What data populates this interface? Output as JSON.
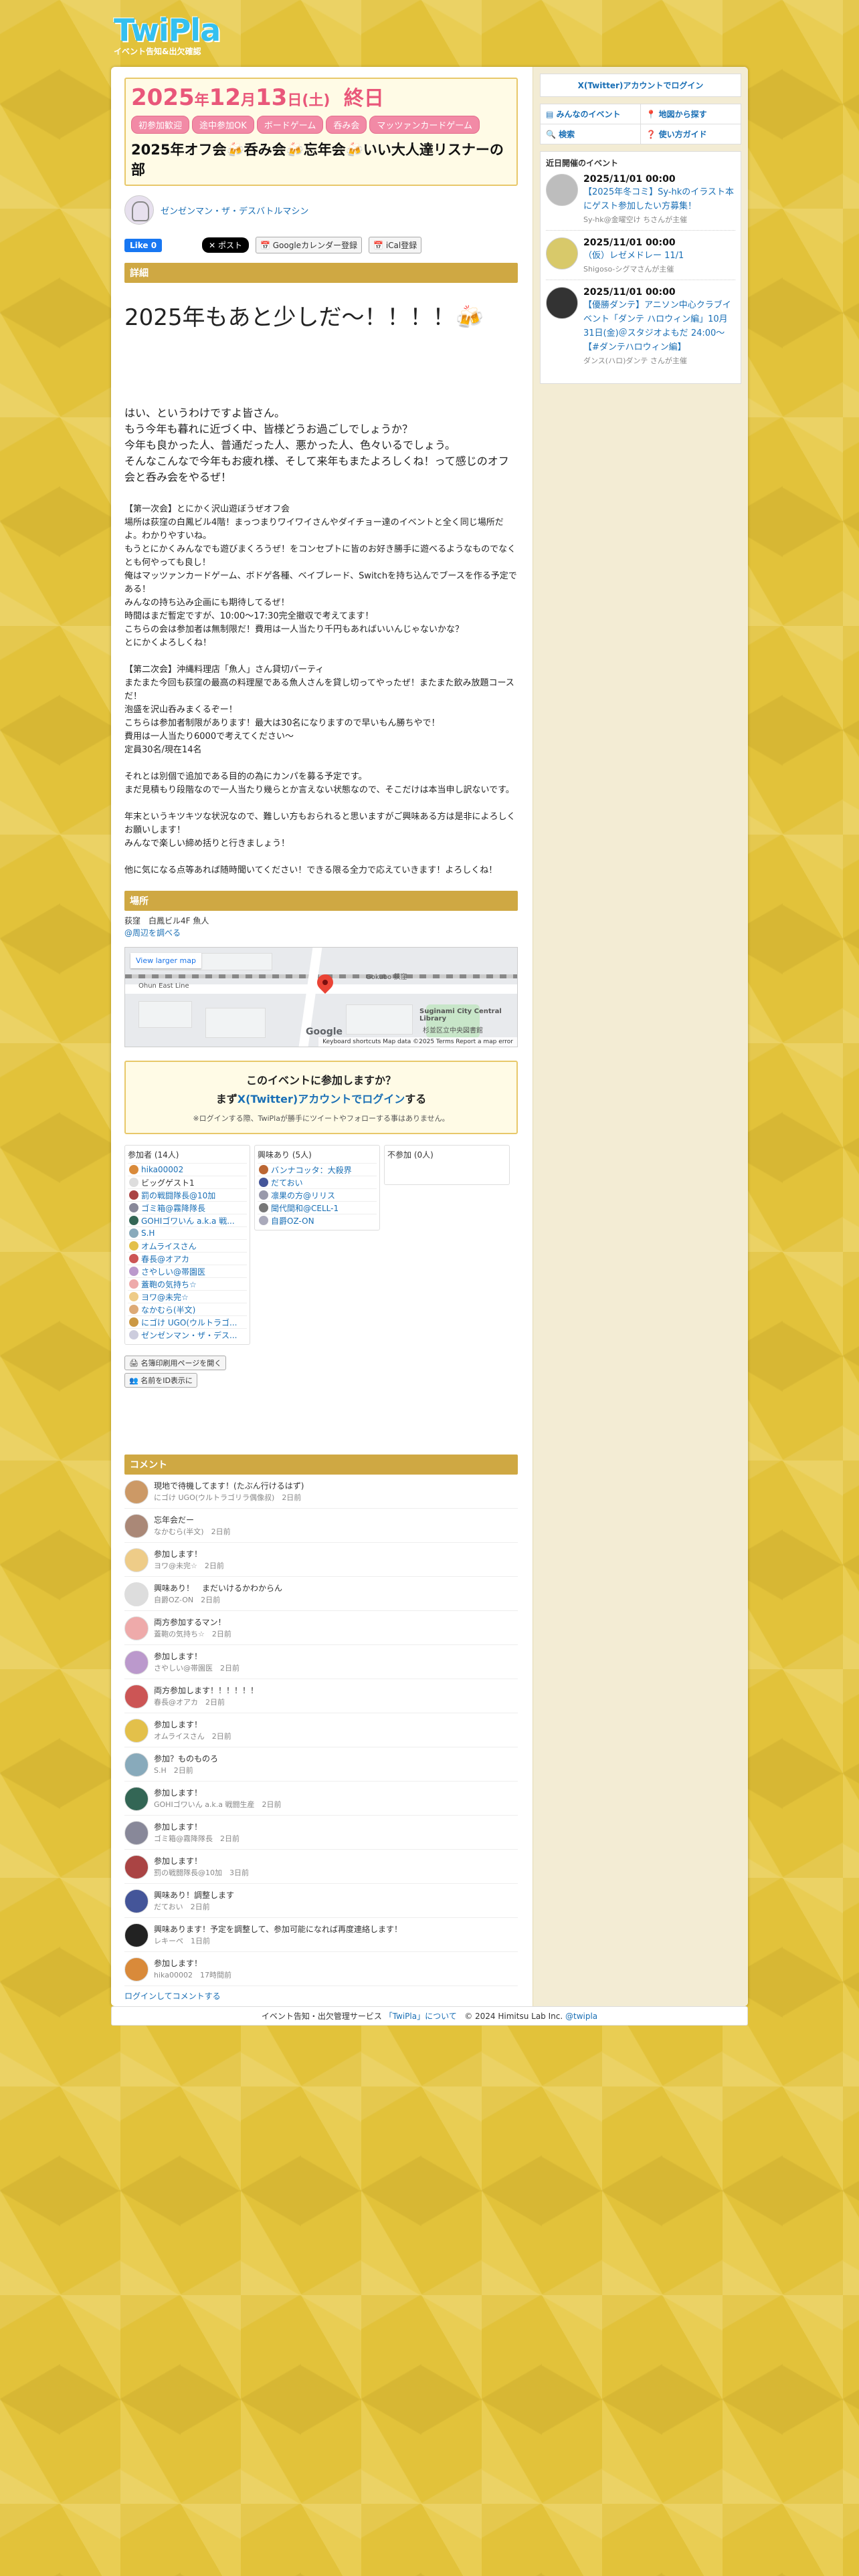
{
  "logo": {
    "title": "TwiPla",
    "subtitle": "イベント告知&出欠確認"
  },
  "event": {
    "date_year": "2025",
    "date_text": "年",
    "date_month": "12",
    "date_month_text": "月",
    "date_day": "13",
    "date_day_text": "日",
    "date_dow": "(土)",
    "date_all_day": "終日",
    "tags": [
      "初参加歓迎",
      "途中参加OK",
      "ボードゲーム",
      "呑み会",
      "マッツァンカードゲーム"
    ],
    "title": "2025年オフ会🍻呑み会🍻忘年会🍻いい大人達リスナーの部"
  },
  "organizer": {
    "name": "ゼンゼンマン・ザ・デスバトルマシン"
  },
  "social": {
    "fb_like": "Like 0",
    "x_post": "ポスト",
    "gcal": "Googleカレンダー登録",
    "ical": "iCal登録"
  },
  "detail": {
    "heading": "詳細",
    "title": "2025年もあと少しだ〜！！！！🍻",
    "intro": [
      "はい、というわけですよ皆さん。",
      "もう今年も暮れに近づく中、皆様どうお過ごしでしょうか？",
      "今年も良かった人、普通だった人、悪かった人、色々いるでしょう。",
      "そんなこんなで今年もお疲れ様、そして来年もまたよろしくね！って感じのオフ会と呑み会をやるぜ！"
    ],
    "part1": [
      "【第一次会】とにかく沢山遊ぼうぜオフ会",
      "場所は荻窪の白鳳ビル4階！まっつまりワイワイさんやダイチョー達のイベントと全く同じ場所だよ。わかりやすいね。",
      "もうとにかくみんなでも遊びまくろうぜ！をコンセプトに皆のお好き勝手に遊べるようなものでなくとも何やっても良し！",
      "俺はマッツァンカードゲーム、ボドゲ各種、ベイブレード、Switchを持ち込んでブースを作る予定である！",
      "みんなの持ち込み企画にも期待してるぜ！",
      "時間はまだ暫定ですが、10:00〜17:30完全撤収で考えてます！",
      "こちらの会は参加者は無制限だ！費用は一人当たり千円もあればいいんじゃないかな？",
      "とにかくよろしくね！"
    ],
    "part2": [
      "【第二次会】沖縄料理店「魚人」さん貸切パーティ",
      "またまた今回も荻窪の最高の料理屋である魚人さんを貸し切ってやったぜ！またまた飲み放題コースだ！",
      "泡盛を沢山呑みまくるぞー！",
      "こちらは参加者制限があります！最大は30名になりますので早いもん勝ちやで！",
      "費用は一人当たり6000で考えてください〜",
      "定員30名/現在14名"
    ],
    "part3": [
      "それとは別個で追加である目的の為にカンパを募る予定です。",
      "まだ見積もり段階なので一人当たり幾らとか言えない状態なので、そこだけは本当申し訳ないです。"
    ],
    "part4": [
      "年末というキツキツな状況なので、難しい方もおられると思いますがご興味ある方は是非によろしくお願いします！",
      "みんなで楽しい締め括りと行きましょう！"
    ],
    "part5": [
      "他に気になる点等あれば随時聞いてください！できる限る全力で応えていきます！よろしくね！"
    ]
  },
  "place": {
    "heading": "場所",
    "text": "荻窪　白鳳ビル4F 魚人",
    "link": "@周辺を調べる"
  },
  "map": {
    "larger": "View larger map",
    "label1": "Gokubo 荻窪",
    "label2": "Suginami City Central Library",
    "label3": "杉並区立中央図書館",
    "label4": "Ohun East Line",
    "footer": "Keyboard shortcuts   Map data ©2025   Terms   Report a map error",
    "google": "Google"
  },
  "join": {
    "question": "このイベントに参加しますか？",
    "login_pre": "まず",
    "login_link": "X(Twitter)アカウントでログイン",
    "login_post": "する",
    "note": "※ログインする際、TwiPlaが勝手にツイートやフォローする事はありません。"
  },
  "attendance": {
    "going": {
      "title": "参加者 (14人)",
      "members": [
        "hika00002",
        "ビッグゲスト1",
        "罰の戦闘隊長@10加",
        "ゴミ箱@霧降隊長",
        "GOHIゴワいん a.k.a 戦...",
        "S.H",
        "オムライスさん",
        "春長@オアカ",
        "さやしい@帯園医",
        "蓋鞄の気持ち☆",
        "ヨワ@未完☆",
        "なかむら(半文)",
        "にゴけ UGO(ウルトラゴ...",
        "ゼンゼンマン・ザ・デス..."
      ]
    },
    "interested": {
      "title": "興味あり (5人)",
      "members": [
        "バンナコッタ：大殺界",
        "だておい",
        "凛果の方@リリス",
        "聞代間和@CELL-1",
        "自爵OZ-ON"
      ]
    },
    "not_going": {
      "title": "不参加 (0人)"
    }
  },
  "small_buttons": [
    "名簿印刷用ページを開く",
    "名前をID表示に"
  ],
  "comments": {
    "heading": "コメント",
    "items": [
      {
        "text": "現地で待機してます！(たぶん行けるはず)",
        "author": "にゴけ UGO(ウルトラゴリラ偶像叔)",
        "time": "2日前"
      },
      {
        "text": "忘年会だー",
        "author": "なかむら(半文)",
        "time": "2日前"
      },
      {
        "text": "参加します！",
        "author": "ヨワ@未完☆",
        "time": "2日前"
      },
      {
        "text": "興味あり！　まだいけるかわからん",
        "author": "自爵OZ-ON",
        "time": "2日前"
      },
      {
        "text": "両方参加するマン！",
        "author": "蓋鞄の気持ち☆",
        "time": "2日前"
      },
      {
        "text": "参加します！",
        "author": "さやしい@帯園医",
        "time": "2日前"
      },
      {
        "text": "両方参加します！！！！！！",
        "author": "春長@オアカ",
        "time": "2日前"
      },
      {
        "text": "参加します！",
        "author": "オムライスさん",
        "time": "2日前"
      },
      {
        "text": "参加？ものものろ",
        "author": "S.H",
        "time": "2日前"
      },
      {
        "text": "参加します！",
        "author": "GOHIゴワいん a.k.a 戦闘生産",
        "time": "2日前"
      },
      {
        "text": "参加します！",
        "author": "ゴミ箱@霧降隊長",
        "time": "2日前"
      },
      {
        "text": "参加します！",
        "author": "罰の戦闘隊長@10加",
        "time": "3日前"
      },
      {
        "text": "興味あり！調整します",
        "author": "だておい",
        "time": "2日前"
      },
      {
        "text": "興味あります！予定を調整して、参加可能になれば再度連絡します！",
        "author": "レキーペ",
        "time": "1日前"
      },
      {
        "text": "参加します！",
        "author": "hika00002",
        "time": "17時間前"
      }
    ],
    "login": "ログインしてコメントする"
  },
  "side": {
    "login": "X(Twitter)アカウントでログイン",
    "nav": [
      "みんなのイベント",
      "地図から探す",
      "検索",
      "使い方ガイド"
    ],
    "recent_title": "近日開催のイベント",
    "recent": [
      {
        "date": "2025/11/01 00:00",
        "title": "【2025年冬コミ】Sy-hkのイラスト本にゲスト参加したい方募集！",
        "org": "Sy-hk@金曜空け ちさんが主催"
      },
      {
        "date": "2025/11/01 00:00",
        "title": "（仮）レゼメドレー 11/1",
        "org": "Shigoso-シグマさんが主催"
      },
      {
        "date": "2025/11/01 00:00",
        "title": "【優勝ダンテ】アニソン中心クラブイベント「ダンテ ハロウィン編」10月31日(金)＠スタジオよもだ 24:00〜【#ダンテハロウィン編】",
        "org": "ダンス(ハロ)ダンテ さんが主催"
      }
    ]
  },
  "footer": {
    "pre": "イベント告知・出欠管理サービス",
    "link": "「TwiPla」について",
    "copy": "© 2024 Himitsu Lab Inc.",
    "handle": "@twipla"
  },
  "colors": {
    "accent": "#e9577a",
    "link": "#1a6fb5",
    "section": "#cfa843",
    "background": "#e2c23a"
  }
}
